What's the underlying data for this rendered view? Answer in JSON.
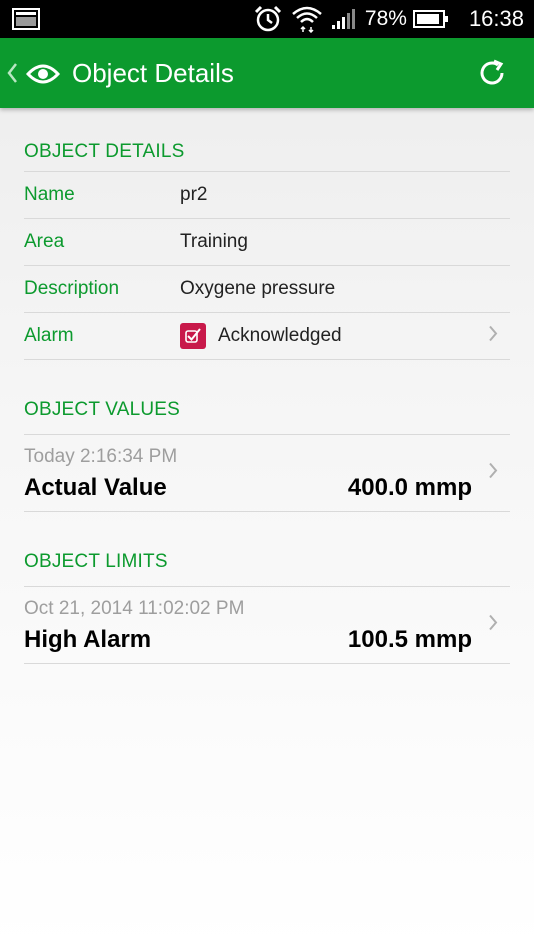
{
  "status_bar": {
    "battery_pct": "78%",
    "time": "16:38"
  },
  "app_bar": {
    "title": "Object Details"
  },
  "details": {
    "header": "OBJECT DETAILS",
    "rows": [
      {
        "label": "Name",
        "value": "pr2"
      },
      {
        "label": "Area",
        "value": "Training"
      },
      {
        "label": "Description",
        "value": "Oxygene pressure"
      },
      {
        "label": "Alarm",
        "value": "Acknowledged"
      }
    ]
  },
  "values": {
    "header": "OBJECT VALUES",
    "items": [
      {
        "time": "Today 2:16:34 PM",
        "name": "Actual Value",
        "reading": "400.0 mmp"
      }
    ]
  },
  "limits": {
    "header": "OBJECT LIMITS",
    "items": [
      {
        "time": "Oct 21, 2014 11:02:02 PM",
        "name": "High Alarm",
        "reading": "100.5 mmp"
      }
    ]
  },
  "colors": {
    "accent": "#0c9a2e",
    "alarm_badge": "#c8194a",
    "status_bar": "#000000"
  }
}
